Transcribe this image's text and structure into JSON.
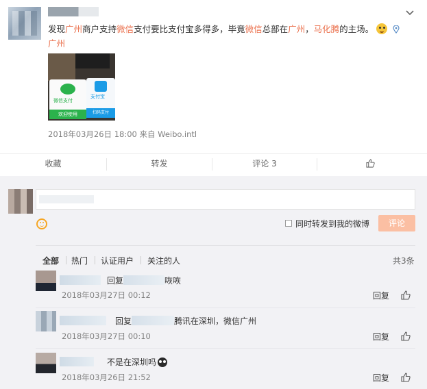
{
  "post": {
    "text_parts": [
      "发现",
      "广州",
      "商户支持",
      "微信",
      "支付要比支付宝多得多，毕竟",
      "微信",
      "总部在",
      "广州",
      "，",
      "马化腾",
      "的主场。"
    ],
    "location": "广州",
    "photo_labels": {
      "wechat_name": "微信支付",
      "wechat_bar": "欢迎使用",
      "alipay_logo": "支付宝",
      "alipay_bar": "扫码支付"
    },
    "meta": "2018年03月26日 18:00 来自 Weibo.intl"
  },
  "actions": {
    "favorite": "收藏",
    "repost": "转发",
    "comment": "评论 3"
  },
  "composer": {
    "repost_label": "同时转发到我的微博",
    "submit": "评论"
  },
  "filters": {
    "all": "全部",
    "hot": "热门",
    "verified": "认证用户",
    "following": "关注的人",
    "total": "共3条"
  },
  "comments": [
    {
      "prefix": "回复",
      "text": "咴咴",
      "time": "2018年03月27日 00:12",
      "reply": "回复"
    },
    {
      "prefix": "回复",
      "text": "腾讯在深圳，微信广州",
      "time": "2018年03月27日 00:10",
      "reply": "回复"
    },
    {
      "prefix": "",
      "text": "不是在深圳吗",
      "time": "2018年03月26日 21:52",
      "reply": "回复"
    }
  ],
  "colors": {
    "highlight": "#eb7350",
    "submit_bg": "#fbbfa3",
    "panel_bg": "#f2f2f5"
  }
}
